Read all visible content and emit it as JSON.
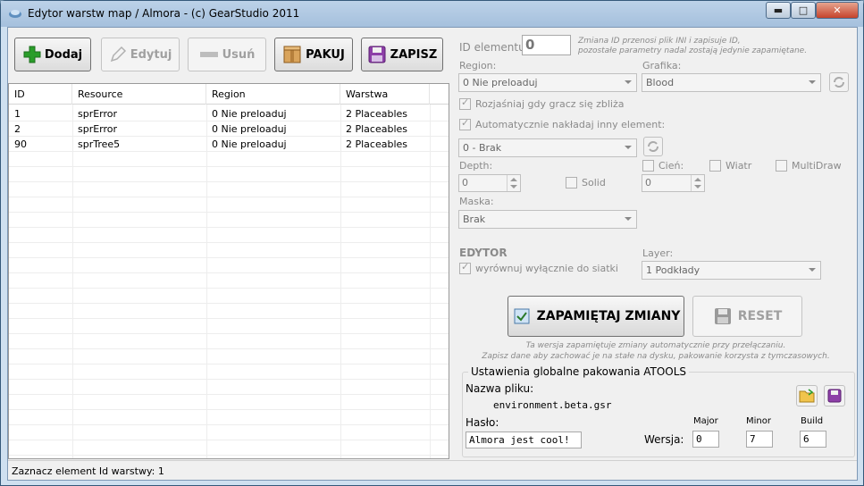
{
  "window": {
    "title": "Edytor warstw map / Almora - (c) GearStudio 2011",
    "minimize": "▬",
    "maximize": "□",
    "close": "✕"
  },
  "toolbar": {
    "add": "Dodaj",
    "edit": "Edytuj",
    "remove": "Usuń",
    "pack": "PAKUJ",
    "save": "ZAPISZ"
  },
  "grid": {
    "columns": [
      "ID",
      "Resource",
      "Region",
      "Warstwa"
    ],
    "rows": [
      [
        "1",
        "sprError",
        "0 Nie preloaduj",
        "2 Placeables"
      ],
      [
        "2",
        "sprError",
        "0 Nie preloaduj",
        "2 Placeables"
      ],
      [
        "90",
        "sprTree5",
        "0 Nie preloaduj",
        "2 Placeables"
      ]
    ]
  },
  "props": {
    "id_label": "ID elementu:",
    "id_value": "0",
    "id_note_1": "Zmiana ID przenosi plik INI i zapisuje ID,",
    "id_note_2": "pozostałe parametry nadal zostają jedynie zapamiętane.",
    "region_label": "Region:",
    "region_value": "0 Nie preloaduj",
    "grafika_label": "Grafika:",
    "grafika_value": "Blood",
    "brighten_label": "Rozjaśniaj gdy gracz się zbliża",
    "auto_label": "Automatycznie nakładaj inny element:",
    "auto_value": "0 - Brak",
    "depth_label": "Depth:",
    "depth_value": "0",
    "solid_label": "Solid",
    "shadow_label": "Cień:",
    "wind_label": "Wiatr",
    "multidraw_label": "MultiDraw",
    "shadow_value": "0",
    "mask_label": "Maska:",
    "mask_value": "Brak",
    "editor_label": "EDYTOR",
    "align_label": "wyrównuj wyłącznie do siatki",
    "layer_label": "Layer:",
    "layer_value": "1 Podkłady",
    "remember_btn": "ZAPAMIĘTAJ ZMIANY",
    "reset_btn": "RESET",
    "note_1": "Ta wersja zapamiętuje zmiany automatycznie przy przełączaniu.",
    "note_2": "Zapisz dane aby zachować je na stałe na dysku, pakowanie korzysta z tymczasowych."
  },
  "atools": {
    "legend": "Ustawienia globalne pakowania ATOOLS",
    "filename_label": "Nazwa pliku:",
    "filename_value": "environment.beta.gsr",
    "password_label": "Hasło:",
    "password_value": "Almora jest cool!",
    "version_label": "Wersja:",
    "major_label": "Major",
    "minor_label": "Minor",
    "build_label": "Build",
    "major_value": "0",
    "minor_value": "7",
    "build_value": "6"
  },
  "status": {
    "text": "Zaznacz element  Id warstwy: 1"
  },
  "colors": {
    "accent": "#2a9d2a",
    "title_bg": "#a5c0dd",
    "disabled_text": "#8a8a8a"
  }
}
